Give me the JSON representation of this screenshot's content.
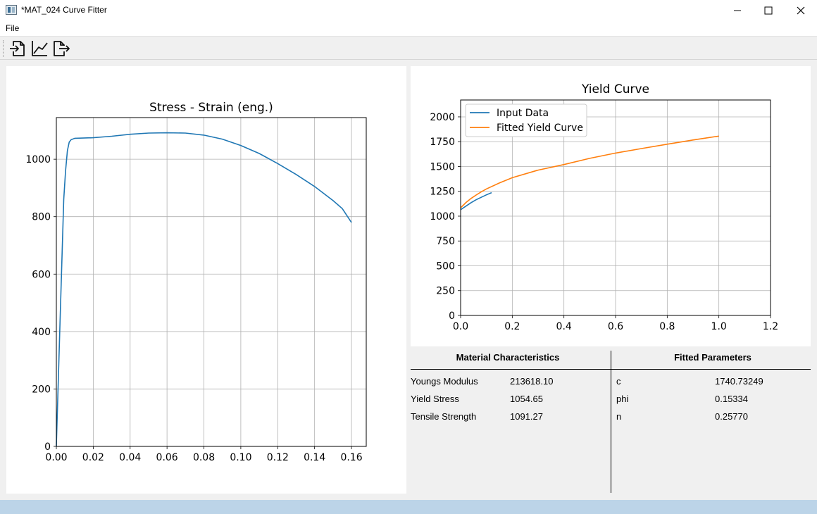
{
  "window": {
    "title": "*MAT_024 Curve Fitter",
    "controls": [
      "minimize-icon",
      "maximize-icon",
      "close-icon"
    ]
  },
  "menu": {
    "file_label": "File"
  },
  "toolbar": {
    "buttons": [
      "import-file-icon",
      "plot-curve-icon",
      "export-file-icon"
    ]
  },
  "colors": {
    "series1": "#1f77b4",
    "series2": "#ff7f0e",
    "grid": "#b0b0b0",
    "statusbar": "#bcd4e8"
  },
  "stress_strain_chart": {
    "title": "Stress - Strain (eng.)",
    "xticks": [
      "0.00",
      "0.02",
      "0.04",
      "0.06",
      "0.08",
      "0.10",
      "0.12",
      "0.14",
      "0.16"
    ],
    "yticks": [
      "0",
      "200",
      "400",
      "600",
      "800",
      "1000"
    ]
  },
  "yield_chart": {
    "title": "Yield Curve",
    "xticks": [
      "0.0",
      "0.2",
      "0.4",
      "0.6",
      "0.8",
      "1.0",
      "1.2"
    ],
    "yticks": [
      "0",
      "250",
      "500",
      "750",
      "1000",
      "1250",
      "1500",
      "1750",
      "2000"
    ],
    "legend": [
      "Input Data",
      "Fitted Yield Curve"
    ]
  },
  "chart_data": [
    {
      "type": "line",
      "title": "Stress - Strain (eng.)",
      "xlabel": "",
      "ylabel": "",
      "xlim": [
        0,
        0.168
      ],
      "ylim": [
        0,
        1145
      ],
      "grid": true,
      "series": [
        {
          "x": [
            0,
            0.002,
            0.004,
            0.005,
            0.006,
            0.007,
            0.008,
            0.01,
            0.02,
            0.03,
            0.04,
            0.05,
            0.06,
            0.07,
            0.08,
            0.09,
            0.1,
            0.11,
            0.12,
            0.13,
            0.14,
            0.15,
            0.155,
            0.16
          ],
          "values": [
            0,
            430,
            860,
            960,
            1030,
            1060,
            1068,
            1073,
            1075,
            1080,
            1087,
            1091,
            1092,
            1091,
            1084,
            1070,
            1048,
            1020,
            985,
            947,
            905,
            856,
            828,
            780
          ]
        }
      ]
    },
    {
      "type": "line",
      "title": "Yield Curve",
      "xlabel": "",
      "ylabel": "",
      "xlim": [
        0,
        1.2
      ],
      "ylim": [
        0,
        2170
      ],
      "grid": true,
      "legend": "top-left",
      "series": [
        {
          "name": "Input Data",
          "x": [
            0,
            0.02,
            0.04,
            0.06,
            0.08,
            0.1,
            0.12
          ],
          "values": [
            1065,
            1100,
            1135,
            1165,
            1190,
            1215,
            1237
          ]
        },
        {
          "name": "Fitted Yield Curve",
          "x": [
            0,
            0.01,
            0.02,
            0.04,
            0.06,
            0.08,
            0.1,
            0.15,
            0.2,
            0.3,
            0.4,
            0.5,
            0.6,
            0.7,
            0.8,
            0.9,
            1.0
          ],
          "values": [
            1084,
            1110,
            1135,
            1178,
            1213,
            1245,
            1274,
            1334,
            1387,
            1464,
            1520,
            1582,
            1635,
            1681,
            1725,
            1767,
            1806
          ]
        }
      ]
    }
  ],
  "tables": {
    "material": {
      "header": "Material Characteristics",
      "rows": [
        {
          "label": "Youngs Modulus",
          "value": "213618.10"
        },
        {
          "label": "Yield Stress",
          "value": "1054.65"
        },
        {
          "label": "Tensile Strength",
          "value": "1091.27"
        }
      ]
    },
    "fitted": {
      "header": "Fitted Parameters",
      "rows": [
        {
          "label": "c",
          "value": "1740.73249"
        },
        {
          "label": "phi",
          "value": "0.15334"
        },
        {
          "label": "n",
          "value": "0.25770"
        }
      ]
    }
  }
}
